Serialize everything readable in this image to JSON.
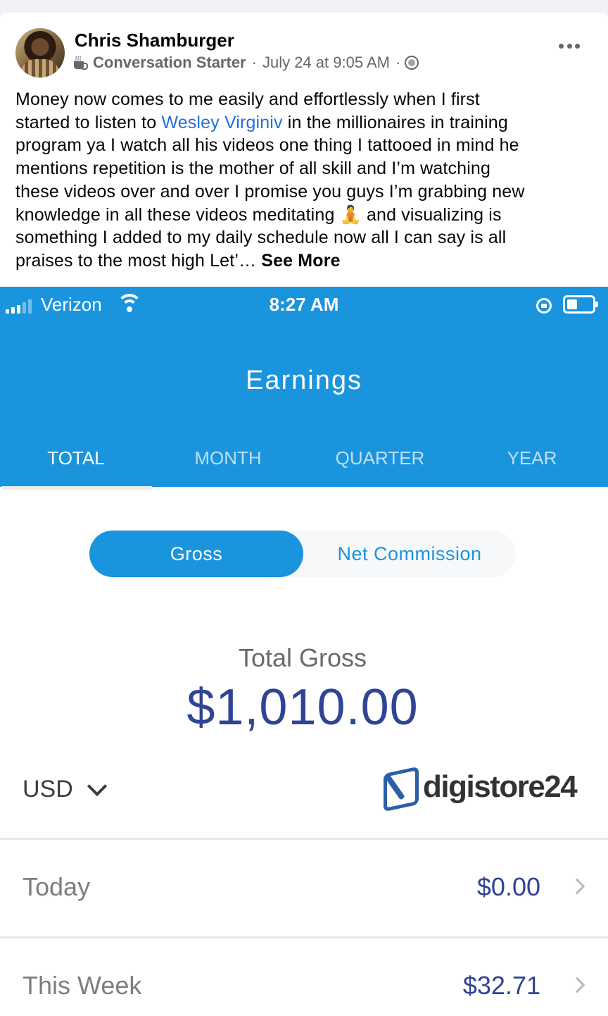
{
  "post": {
    "author": "Chris Shamburger",
    "badge": "Conversation Starter",
    "separator": "·",
    "timestamp": "July 24 at 9:05 AM",
    "text_lines": [
      "Money now comes to me easily and effortlessly when I first",
      "started to listen to ",
      " in the millionaires in training",
      "program ya I watch all his videos one thing I tattooed in mind he",
      "mentions repetition is the mother of all skill and I’m watching",
      "these videos over and over I promise you guys I’m grabbing new",
      "knowledge in all these videos meditating 🧘 and visualizing is",
      "something I added to my daily schedule now all I can say is  all",
      "praises to the most high Let’… "
    ],
    "mention": "Wesley Virginiv",
    "see_more": "See More"
  },
  "screenshot": {
    "status_bar": {
      "carrier": "Verizon",
      "time": "8:27 AM"
    },
    "title": "Earnings",
    "tabs": [
      "TOTAL",
      "MONTH",
      "QUARTER",
      "YEAR"
    ],
    "active_tab": "TOTAL",
    "toggle": {
      "selected": "Gross",
      "other": "Net Commission"
    },
    "total_label": "Total Gross",
    "total_value": "$1,010.00",
    "currency": "USD",
    "brand": "digistore24",
    "rows": [
      {
        "label": "Today",
        "value": "$0.00"
      },
      {
        "label": "This Week",
        "value": "$32.71"
      }
    ]
  },
  "colors": {
    "header_blue": "#1b94de",
    "amount_navy": "#2f4496",
    "link_blue": "#216fdb"
  },
  "icons": [
    "coffee-cup-icon",
    "globe-icon",
    "more-icon",
    "signal-icon",
    "wifi-icon",
    "rotation-lock-icon",
    "battery-icon",
    "chevron-down-icon",
    "digistore24-logo-icon",
    "chevron-right-icon"
  ]
}
